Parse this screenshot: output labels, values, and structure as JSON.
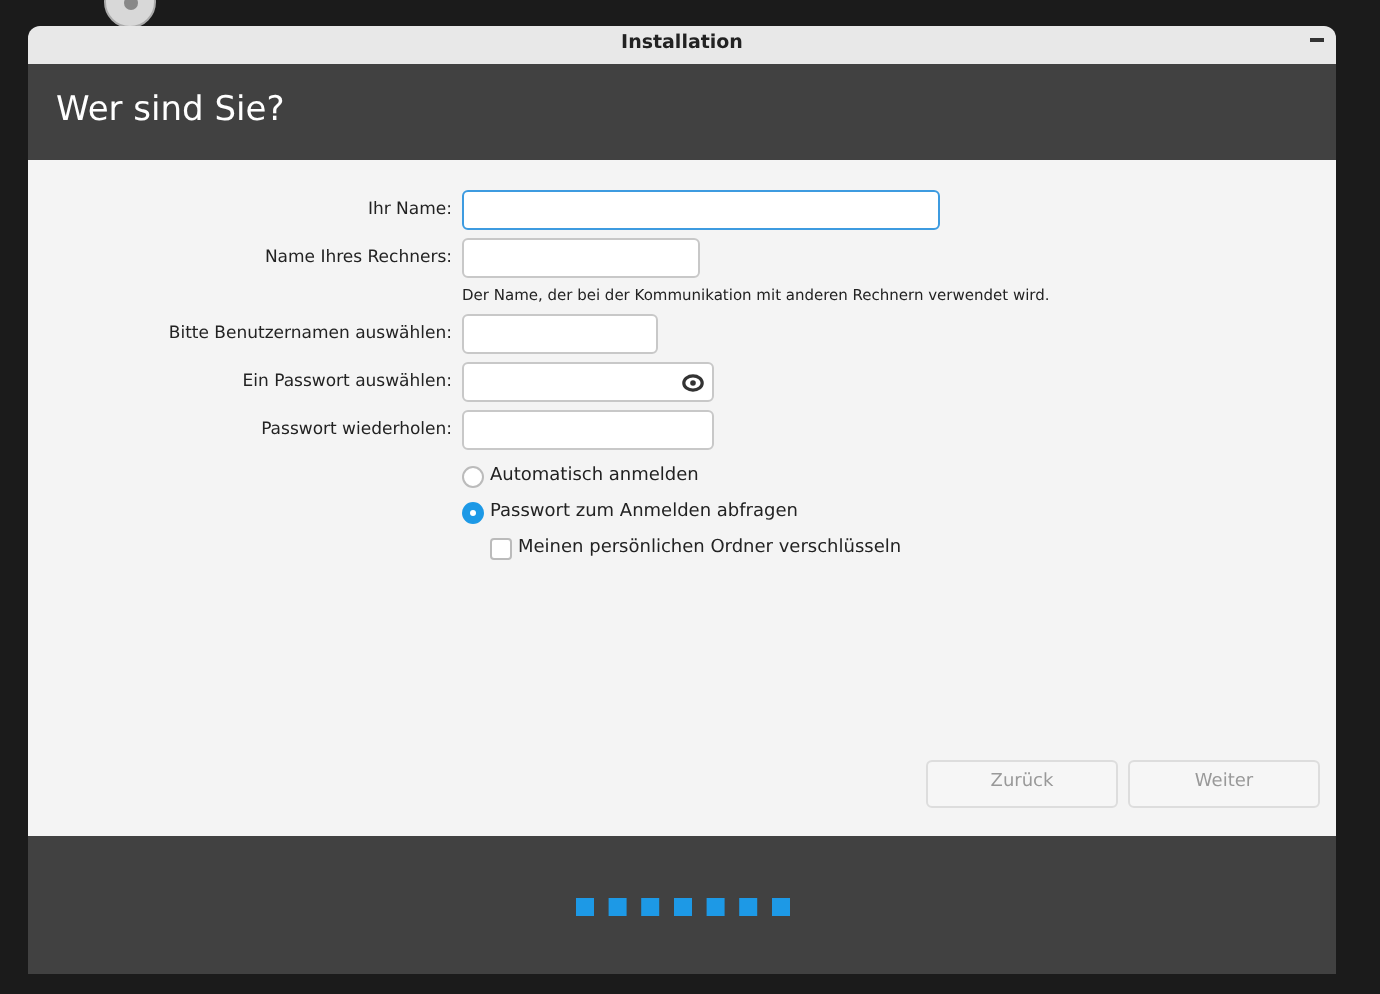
{
  "window": {
    "title": "Installation"
  },
  "header": {
    "title": "Wer sind Sie?"
  },
  "fields": [
    {
      "label": "Ihr Name:",
      "focused": true
    },
    {
      "label": "Name Ihres Rechners:",
      "focused": false,
      "hint": "Der Name, der bei der Kommunikation mit anderen Rechnern verwendet wird."
    },
    {
      "label": "Bitte Benutzernamen auswählen:",
      "focused": false
    },
    {
      "label": "Ein Passwort auswählen:",
      "focused": false,
      "reveal_icon": true
    },
    {
      "label": "Passwort wiederholen:",
      "focused": false
    }
  ],
  "login_options": [
    {
      "kind": "radio",
      "label": "Automatisch anmelden",
      "selected": false
    },
    {
      "kind": "radio",
      "label": "Passwort zum Anmelden abfragen",
      "selected": true
    },
    {
      "kind": "checkbox",
      "label": "Meinen persönlichen Ordner verschlüsseln",
      "checked": false
    }
  ],
  "buttons": [
    {
      "label": "Zurück",
      "disabled": true
    },
    {
      "label": "Weiter",
      "disabled": true
    }
  ]
}
